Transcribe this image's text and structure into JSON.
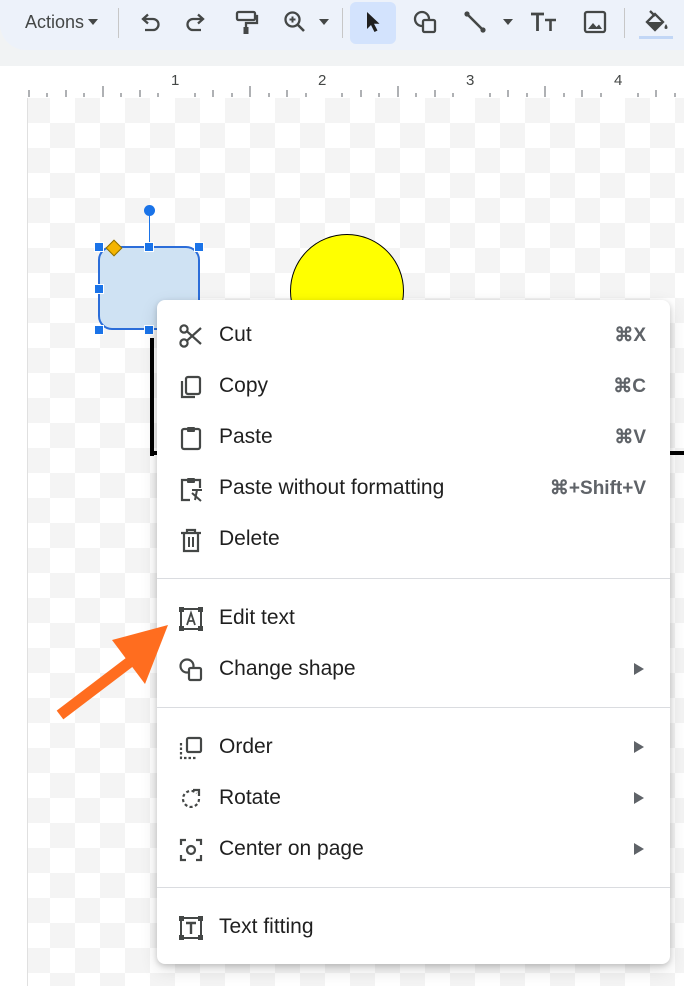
{
  "toolbar": {
    "actions_label": "Actions",
    "icons": [
      "undo-icon",
      "redo-icon",
      "paint-format-icon",
      "zoom-icon",
      "select-icon",
      "shape-icon",
      "line-icon",
      "text-box-icon",
      "image-icon",
      "fill-color-icon"
    ]
  },
  "ruler": {
    "numbers": [
      "1",
      "2",
      "3",
      "4"
    ]
  },
  "context_menu": {
    "items": [
      {
        "label": "Cut",
        "shortcut": "⌘X",
        "icon": "scissors-icon"
      },
      {
        "label": "Copy",
        "shortcut": "⌘C",
        "icon": "copy-icon"
      },
      {
        "label": "Paste",
        "shortcut": "⌘V",
        "icon": "clipboard-icon"
      },
      {
        "label": "Paste without formatting",
        "shortcut": "⌘+Shift+V",
        "icon": "clipboard-clear-format-icon"
      },
      {
        "label": "Delete",
        "shortcut": "",
        "icon": "trash-icon"
      },
      {
        "label": "Edit text",
        "shortcut": "",
        "icon": "edit-text-icon"
      },
      {
        "label": "Change shape",
        "shortcut": "",
        "icon": "change-shape-icon",
        "submenu": true
      },
      {
        "label": "Order",
        "shortcut": "",
        "icon": "order-icon",
        "submenu": true
      },
      {
        "label": "Rotate",
        "shortcut": "",
        "icon": "rotate-icon",
        "submenu": true
      },
      {
        "label": "Center on page",
        "shortcut": "",
        "icon": "center-icon",
        "submenu": true
      },
      {
        "label": "Text fitting",
        "shortcut": "",
        "icon": "text-fitting-icon"
      }
    ]
  },
  "colors": {
    "accent": "#1a73e8",
    "selected_shape_fill": "#cfe2f3",
    "circle_fill": "#ffff00",
    "annotation_arrow": "#ff6d1f"
  }
}
